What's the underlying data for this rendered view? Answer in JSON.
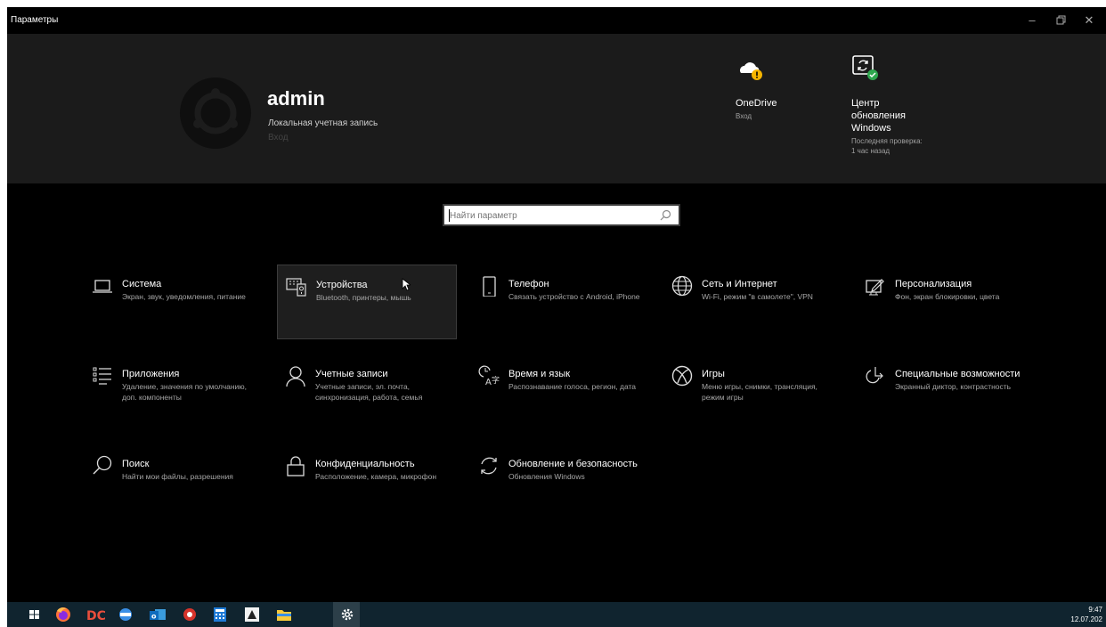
{
  "window": {
    "title": "Параметры"
  },
  "account": {
    "name": "admin",
    "type": "Локальная учетная запись",
    "sign_in": "Вход"
  },
  "status_cards": [
    {
      "title": "OneDrive",
      "sub": "Вход",
      "icon": "onedrive-warning-icon"
    },
    {
      "title": "Центр обновления Windows",
      "sub": "Последняя проверка: 1 час назад",
      "icon": "windows-update-ok-icon"
    }
  ],
  "search": {
    "placeholder": "Найти параметр",
    "value": ""
  },
  "categories": [
    {
      "title": "Система",
      "desc": "Экран, звук, уведомления, питание",
      "icon": "laptop-icon"
    },
    {
      "title": "Устройства",
      "desc": "Bluetooth, принтеры, мышь",
      "icon": "devices-icon"
    },
    {
      "title": "Телефон",
      "desc": "Связать устройство с Android, iPhone",
      "icon": "phone-icon"
    },
    {
      "title": "Сеть и Интернет",
      "desc": "Wi-Fi, режим \"в самолете\", VPN",
      "icon": "globe-icon"
    },
    {
      "title": "Персонализация",
      "desc": "Фон, экран блокировки, цвета",
      "icon": "personalization-icon"
    },
    {
      "title": "Приложения",
      "desc": "Удаление, значения по умолчанию, доп. компоненты",
      "icon": "apps-list-icon"
    },
    {
      "title": "Учетные записи",
      "desc": "Учетные записи, эл. почта, синхронизация, работа, семья",
      "icon": "person-icon"
    },
    {
      "title": "Время и язык",
      "desc": "Распознавание голоса, регион, дата",
      "icon": "time-language-icon"
    },
    {
      "title": "Игры",
      "desc": "Меню игры, снимки, трансляция, режим игры",
      "icon": "xbox-icon"
    },
    {
      "title": "Специальные возможности",
      "desc": "Экранный диктор, контрастность",
      "icon": "ease-of-access-icon"
    },
    {
      "title": "Поиск",
      "desc": "Найти мои файлы, разрешения",
      "icon": "search-icon"
    },
    {
      "title": "Конфиденциальность",
      "desc": "Расположение, камера, микрофон",
      "icon": "lock-icon"
    },
    {
      "title": "Обновление и безопасность",
      "desc": "Обновления Windows",
      "icon": "sync-icon"
    }
  ],
  "taskbar": {
    "time": "9:47",
    "date": "12.07.202",
    "apps": [
      "start-icon",
      "firefox-icon",
      "app-dc-icon",
      "app-round-icon",
      "outlook-icon",
      "app-red-icon",
      "calculator-icon",
      "app-triangle-icon",
      "file-explorer-icon",
      "settings-icon"
    ]
  },
  "colors": {
    "background": "#000000",
    "header": "#1b1b1b",
    "taskbar": "#10242f",
    "onedrive_warning": "#f5b400",
    "update_ok": "#2fa84f"
  }
}
